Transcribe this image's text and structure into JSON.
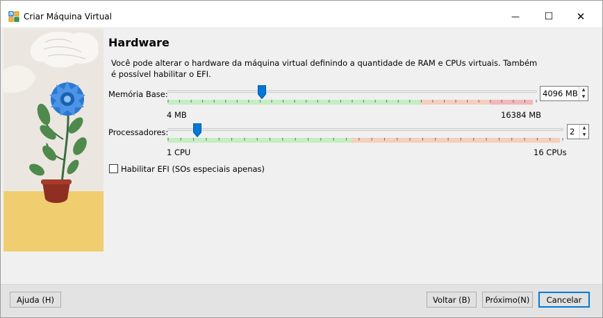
{
  "window": {
    "title": "Criar Máquina Virtual",
    "minimize_glyph": "—",
    "maximize_glyph": "☐",
    "close_glyph": "✕"
  },
  "page": {
    "heading": "Hardware",
    "description": "Você pode alterar o hardware da máquina virtual definindo a quantidade de RAM e CPUs virtuais. Também é possível habilitar o EFI."
  },
  "memory": {
    "label": "Memória Base:",
    "value": "4096 MB",
    "min_label": "4 MB",
    "max_label": "16384 MB",
    "level": 0.25
  },
  "cpu": {
    "label": "Processadores:",
    "value": "2",
    "min_label": "1 CPU",
    "max_label": "16 CPUs",
    "level": 0.0667
  },
  "efi": {
    "label": "Habilitar EFI (SOs especiais apenas)",
    "checked": false
  },
  "buttons": {
    "help": "Ajuda (H)",
    "back": "Voltar (B)",
    "next": "Próximo(N)",
    "cancel": "Cancelar"
  },
  "colors": {
    "accent": "#0078d7",
    "zone_green": "#c5eec3",
    "zone_orange": "#f5cfbd",
    "zone_red": "#f4b7b9"
  },
  "icons": {
    "app": "virtualbox-logo-icon",
    "spin_up": "up-arrow-icon",
    "spin_down": "down-arrow-icon"
  }
}
